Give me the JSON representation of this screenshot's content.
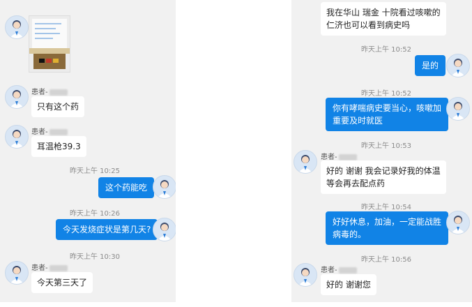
{
  "left": {
    "messages": [
      {
        "kind": "image",
        "sender": "doctor"
      },
      {
        "kind": "text",
        "side": "in",
        "sender_label": "患者-",
        "text": "只有这个药"
      },
      {
        "kind": "text",
        "side": "in",
        "sender_label": "患者-",
        "text": "耳温枪39.3"
      },
      {
        "kind": "timestamp",
        "text": "昨天上午 10:25"
      },
      {
        "kind": "text",
        "side": "out",
        "text": "这个药能吃"
      },
      {
        "kind": "timestamp",
        "text": "昨天上午 10:26"
      },
      {
        "kind": "text",
        "side": "out",
        "text": "今天发烧症状是第几天?"
      },
      {
        "kind": "timestamp",
        "text": "昨天上午 10:30"
      },
      {
        "kind": "text",
        "side": "in",
        "sender_label": "患者-",
        "text": "今天第三天了"
      }
    ]
  },
  "right": {
    "messages": [
      {
        "kind": "text",
        "side": "in",
        "text_lines": [
          "我在华山 瑞金 十院看过咳嗽的",
          "仁济也可以看到病史吗"
        ]
      },
      {
        "kind": "timestamp",
        "text": "昨天上午 10:52"
      },
      {
        "kind": "text",
        "side": "out",
        "text": "是的"
      },
      {
        "kind": "timestamp",
        "text": "昨天上午 10:52"
      },
      {
        "kind": "text",
        "side": "out",
        "text_lines": [
          "你有哮喘病史要当心，咳嗽加",
          "重要及时就医"
        ]
      },
      {
        "kind": "timestamp",
        "text": "昨天上午 10:53"
      },
      {
        "kind": "text",
        "side": "in",
        "sender_label": "患者-",
        "text_lines": [
          "好的 谢谢 我会记录好我的体温",
          "等会再去配点药"
        ]
      },
      {
        "kind": "timestamp",
        "text": "昨天上午 10:54"
      },
      {
        "kind": "text",
        "side": "out",
        "text_lines": [
          "好好休息，加油，一定能战胜",
          "病毒的。"
        ]
      },
      {
        "kind": "timestamp",
        "text": "昨天上午 10:56"
      },
      {
        "kind": "text",
        "side": "in",
        "sender_label": "患者-",
        "text": "好的 谢谢您"
      }
    ]
  },
  "icons": {
    "avatar": "user-avatar-icon"
  },
  "colors": {
    "outgoing_bubble": "#1183e6",
    "panel_bg": "#f1f1f1",
    "incoming_bubble": "#ffffff"
  }
}
